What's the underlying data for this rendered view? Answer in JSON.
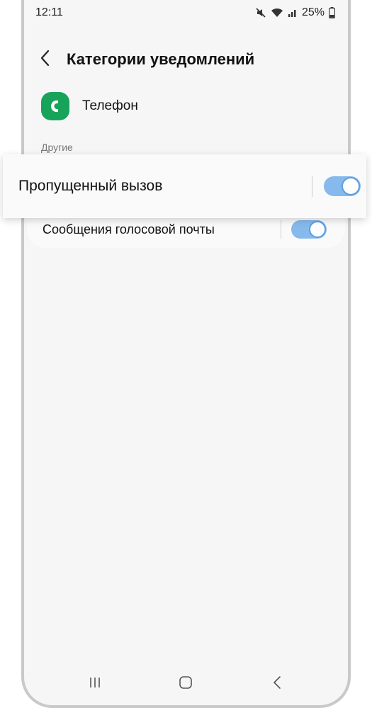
{
  "status_bar": {
    "time": "12:11",
    "battery": "25%",
    "icons": [
      "mute-icon",
      "wifi-icon",
      "signal-icon",
      "battery-icon"
    ]
  },
  "header": {
    "back_icon": "chevron-left-icon",
    "title": "Категории уведомлений"
  },
  "app": {
    "name": "Телефон",
    "icon": "phone-icon",
    "icon_color": "#18a35a"
  },
  "section": {
    "label": "Другие"
  },
  "items": [
    {
      "label": "Пропущенный вызов",
      "enabled": true
    },
    {
      "label": "Сообщения голосовой почты",
      "enabled": true
    }
  ],
  "colors": {
    "toggle_track": "#86b9ec",
    "toggle_knob_border": "#5f9ee0"
  },
  "nav_bar": {
    "icons": [
      "recents-icon",
      "home-icon",
      "back-icon"
    ]
  }
}
